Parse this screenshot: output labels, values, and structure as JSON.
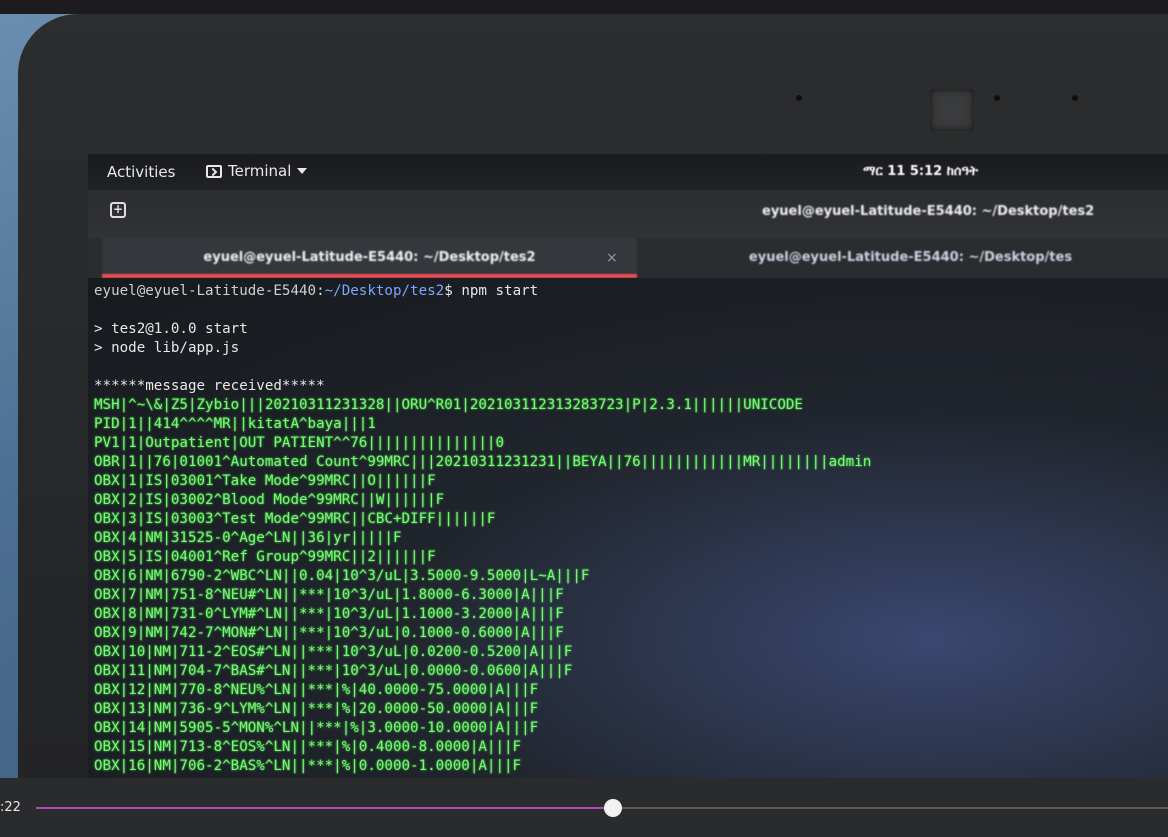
{
  "topbar": {
    "activities": "Activities",
    "app_name": "Terminal",
    "clock": "ማር 11  5:12 ከሰዓት"
  },
  "header": {
    "window_title": "eyuel@eyuel-Latitude-E5440: ~/Desktop/tes2"
  },
  "tabs": [
    {
      "label": "eyuel@eyuel-Latitude-E5440: ~/Desktop/tes2",
      "active": true
    },
    {
      "label": "eyuel@eyuel-Latitude-E5440: ~/Desktop/tes",
      "active": false
    }
  ],
  "terminal": {
    "prompt_user": "eyuel@eyuel-Latitude-E5440",
    "prompt_path": "~/Desktop/tes2",
    "command": "npm start",
    "npm_lines": [
      "> tes2@1.0.0 start",
      "> node lib/app.js"
    ],
    "message_header": "******message received*****",
    "hl7_lines": [
      "MSH|^~\\&|Z5|Zybio|||20210311231328||ORU^R01|20210311231328372З|P|2.3.1||||||UNICODE",
      "PID|1||414^^^^MR||kitatA^baya|||1",
      "PV1|1|Outpatient|OUT PATIENT^^76|||||||||||||||0",
      "OBR|1||76|01001^Automated Count^99MRC|||20210311231231||BEYA||76||||||||||||MR||||||||admin",
      "OBX|1|IS|03001^Take Mode^99MRC||O||||||F",
      "OBX|2|IS|03002^Blood Mode^99MRC||W||||||F",
      "OBX|3|IS|03003^Test Mode^99MRC||CBC+DIFF||||||F",
      "OBX|4|NM|31525-0^Age^LN||36|yr|||||F",
      "OBX|5|IS|04001^Ref Group^99MRC||2||||||F",
      "OBX|6|NM|6790-2^WBC^LN||0.04|10^3/uL|3.5000-9.5000|L~A|||F",
      "OBX|7|NM|751-8^NEU#^LN||***|10^3/uL|1.8000-6.3000|A|||F",
      "OBX|8|NM|731-0^LYM#^LN||***|10^3/uL|1.1000-3.2000|A|||F",
      "OBX|9|NM|742-7^MON#^LN||***|10^3/uL|0.1000-0.6000|A|||F",
      "OBX|10|NM|711-2^EOS#^LN||***|10^3/uL|0.0200-0.5200|A|||F",
      "OBX|11|NM|704-7^BAS#^LN||***|10^3/uL|0.0000-0.0600|A|||F",
      "OBX|12|NM|770-8^NEU%^LN||***|%|40.0000-75.0000|A|||F",
      "OBX|13|NM|736-9^LYM%^LN||***|%|20.0000-50.0000|A|||F",
      "OBX|14|NM|5905-5^MON%^LN||***|%|3.0000-10.0000|A|||F",
      "OBX|15|NM|713-8^EOS%^LN||***|%|0.4000-8.0000|A|||F",
      "OBX|16|NM|706-2^BAS%^LN||***|%|0.0000-1.0000|A|||F"
    ]
  },
  "player": {
    "time": ":22",
    "progress": 0.51,
    "accent_color": "#b149b5"
  }
}
